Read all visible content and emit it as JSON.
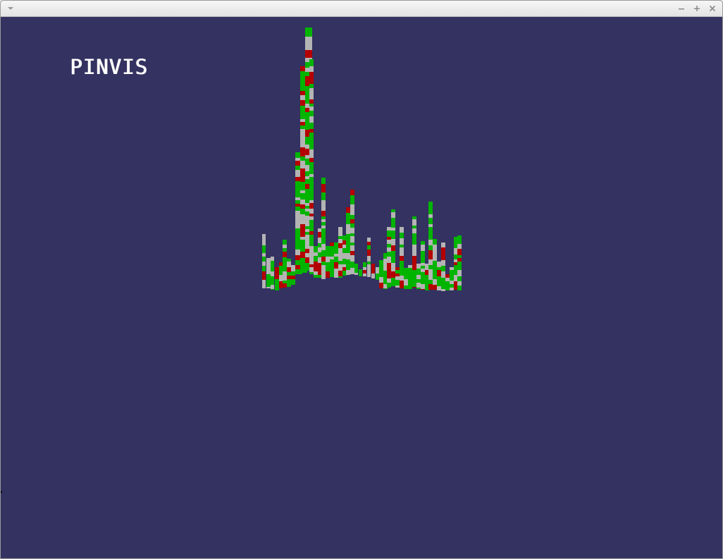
{
  "window": {
    "controls": [
      "minimize-icon",
      "maximize-icon",
      "close-icon"
    ],
    "titlebar_color": "#ececec"
  },
  "app": {
    "title": "PINVIS",
    "background_color": "#343261"
  },
  "visualization": {
    "type": "3d-bar-histogram",
    "colors": {
      "green": "#00b400",
      "gray": "#b4b4b4",
      "red": "#b40000"
    }
  }
}
